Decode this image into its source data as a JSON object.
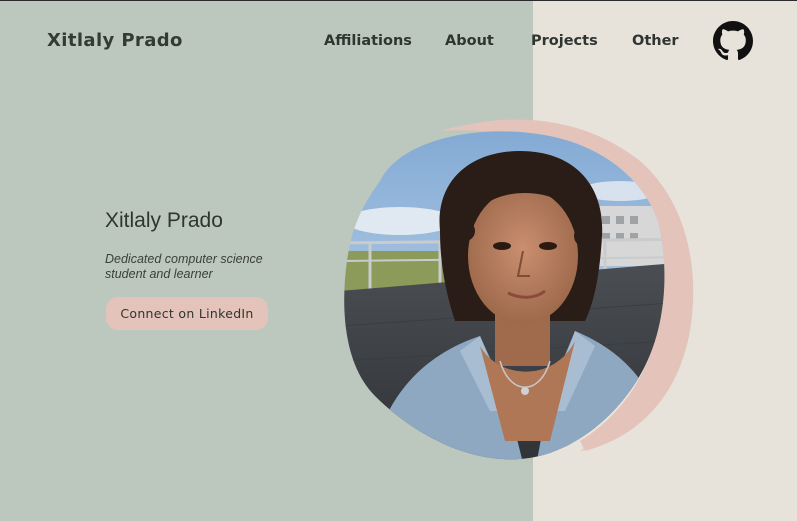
{
  "header": {
    "brand": "Xitlaly Prado",
    "nav": [
      {
        "label": "Affiliations"
      },
      {
        "label": "About"
      },
      {
        "label": "Projects"
      },
      {
        "label": "Other"
      }
    ],
    "github_icon": "github-icon"
  },
  "hero": {
    "name": "Xitlaly Prado",
    "tagline": "Dedicated computer science student and learner",
    "cta_label": "Connect on LinkedIn",
    "photo": "profile-photo"
  },
  "colors": {
    "left_bg": "#bcc7bd",
    "right_bg": "#e8e3da",
    "accent_blob": "#e3c3ba",
    "text_dark": "#2f3531"
  }
}
